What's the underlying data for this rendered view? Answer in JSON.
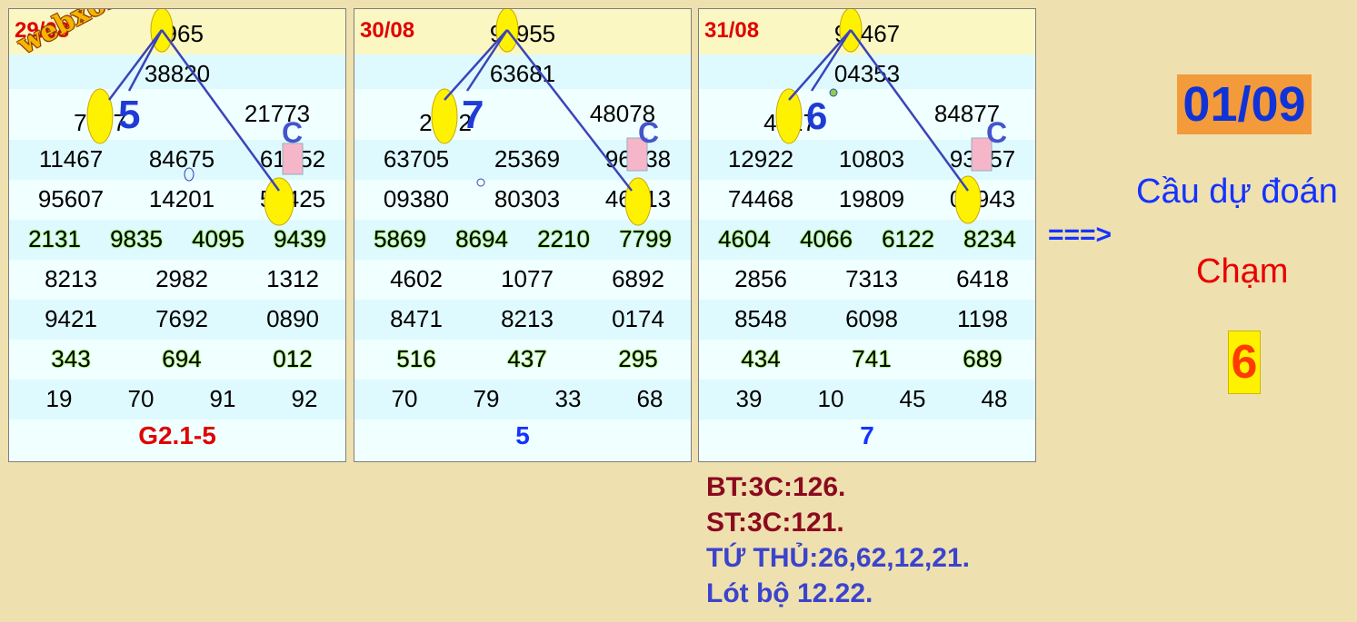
{
  "panels": [
    {
      "date": "29/08",
      "rows": [
        [
          "8965"
        ],
        [
          "38820"
        ],
        [
          "7157",
          "21773"
        ],
        [
          "11467",
          "84675",
          "61952"
        ],
        [
          "95607",
          "14201",
          "55425"
        ],
        [
          "2131",
          "9835",
          "4095",
          "9439"
        ],
        [
          "8213",
          "2982",
          "1312"
        ],
        [
          "9421",
          "7692",
          "0890"
        ],
        [
          "343",
          "694",
          "012"
        ],
        [
          "19",
          "70",
          "91",
          "92"
        ]
      ],
      "footer": "G2.1-5",
      "footer_color": "#e00000",
      "big_digit": "5",
      "c_mark": "C"
    },
    {
      "date": "30/08",
      "rows": [
        [
          "96955"
        ],
        [
          "63681"
        ],
        [
          "2072",
          "48078"
        ],
        [
          "63705",
          "25369",
          "96438"
        ],
        [
          "09380",
          "80303",
          "46713"
        ],
        [
          "5869",
          "8694",
          "2210",
          "7799"
        ],
        [
          "4602",
          "1077",
          "6892"
        ],
        [
          "8471",
          "8213",
          "0174"
        ],
        [
          "516",
          "437",
          "295"
        ],
        [
          "70",
          "79",
          "33",
          "68"
        ]
      ],
      "footer": "5",
      "footer_color": "#1533ff",
      "big_digit": "7",
      "c_mark": "C"
    },
    {
      "date": "31/08",
      "rows": [
        [
          "92467"
        ],
        [
          "04353"
        ],
        [
          "4217",
          "84877"
        ],
        [
          "12922",
          "10803",
          "93157"
        ],
        [
          "74468",
          "19809",
          "02943"
        ],
        [
          "4604",
          "4066",
          "6122",
          "8234"
        ],
        [
          "2856",
          "7313",
          "6418"
        ],
        [
          "8548",
          "6098",
          "1198"
        ],
        [
          "434",
          "741",
          "689"
        ],
        [
          "39",
          "10",
          "45",
          "48"
        ]
      ],
      "footer": "7",
      "footer_color": "#1533ff",
      "big_digit": "6",
      "c_mark": "C"
    }
  ],
  "watermark": "webxoso.net",
  "side": {
    "date": "01/09",
    "arrow": "===>",
    "title": "Cầu dự đoán",
    "subtitle": "Chạm",
    "digit": "6"
  },
  "notes": {
    "bt": "BT:3C:126.",
    "st": "ST:3C:121.",
    "tu_thu": "TỨ THỦ:26,62,12,21.",
    "lot_bo": "Lót bộ 12.22."
  },
  "colors": {
    "background": "#efe0b0",
    "panel_bg": "#f0ffff",
    "highlight_yellow": "#fff200",
    "line_blue": "#3b44b8",
    "date_red": "#e00000",
    "note_dark_red": "#8b0a1e",
    "note_blue": "#3b44cc"
  }
}
